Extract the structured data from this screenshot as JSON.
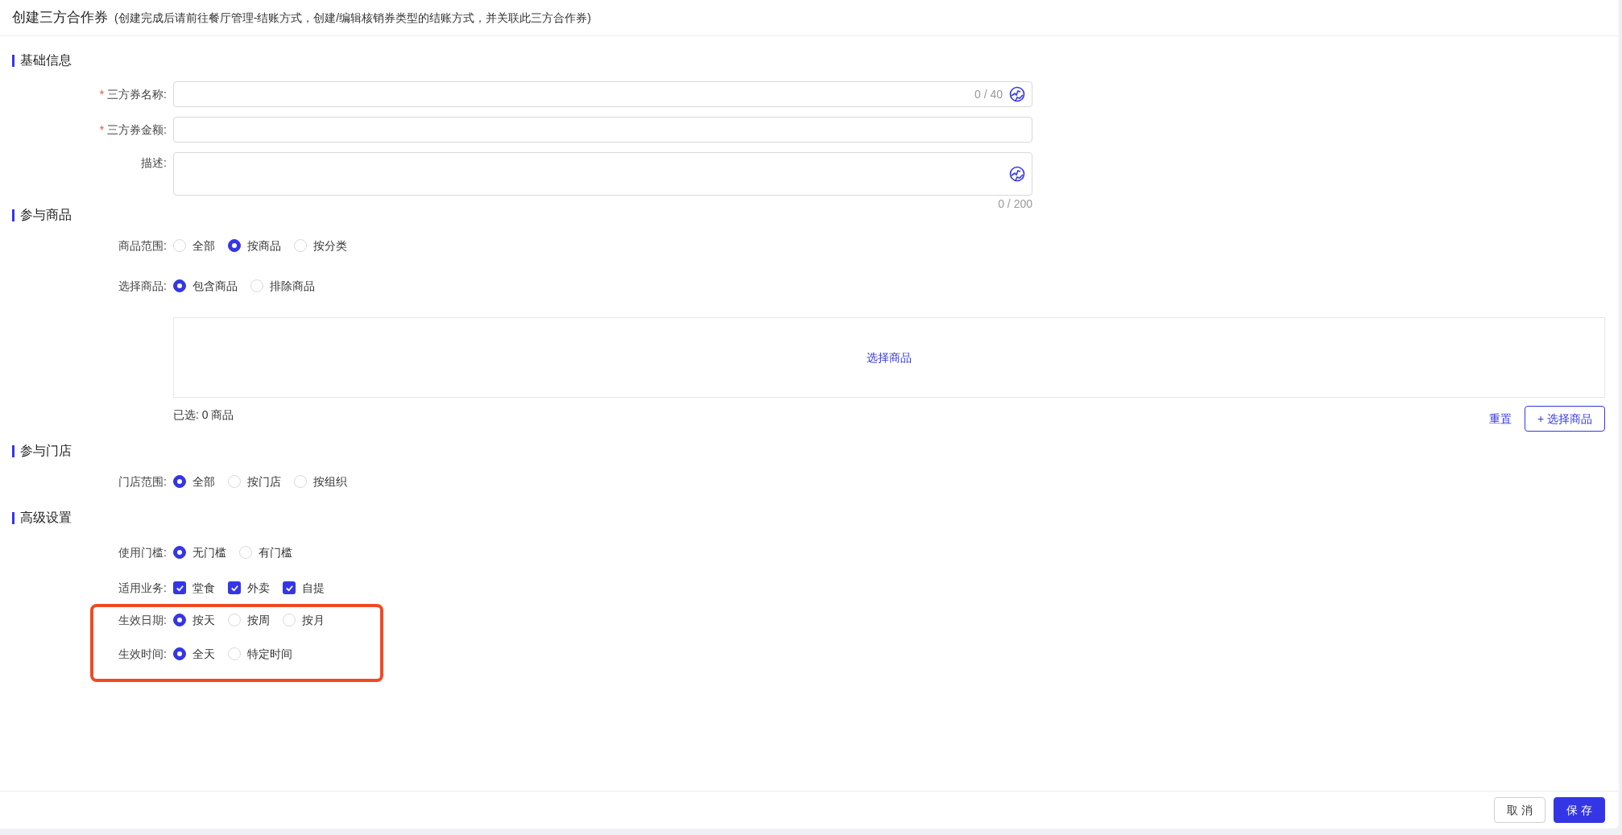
{
  "header": {
    "title": "创建三方合作券",
    "note": "(创建完成后请前往餐厅管理-结账方式，创建/编辑核销券类型的结账方式，并关联此三方合作券)"
  },
  "sections": [
    {
      "title": "基础信息",
      "fields": [
        {
          "kind": "input",
          "label": "三方券名称:",
          "required_mark": "*",
          "counter": "0 / 40",
          "icon_button": true
        },
        {
          "kind": "input",
          "label": "三方券金额:",
          "required_mark": "*",
          "icon_button": false
        },
        {
          "kind": "textarea",
          "label": "描述:",
          "counter": "0 / 200",
          "icon_button": true
        }
      ]
    },
    {
      "title": "参与商品",
      "fields": [
        {
          "kind": "radio",
          "label": "商品范围:",
          "highlighted": false,
          "options": [
            {
              "label": "全部",
              "selected": false
            },
            {
              "label": "按商品",
              "selected": true
            },
            {
              "label": "按分类",
              "selected": false
            }
          ]
        },
        {
          "kind": "radio",
          "label": "选择商品:",
          "highlighted": false,
          "options": [
            {
              "label": "包含商品",
              "selected": true
            },
            {
              "label": "排除商品",
              "selected": false
            }
          ]
        },
        {
          "kind": "picker",
          "link": "选择商品",
          "summary": "已选: 0 商品",
          "reset": "重置",
          "add": "+ 选择商品"
        }
      ]
    },
    {
      "title": "参与门店",
      "fields": [
        {
          "kind": "radio",
          "label": "门店范围:",
          "highlighted": false,
          "options": [
            {
              "label": "全部",
              "selected": true
            },
            {
              "label": "按门店",
              "selected": false
            },
            {
              "label": "按组织",
              "selected": false
            }
          ]
        }
      ]
    },
    {
      "title": "高级设置",
      "fields": [
        {
          "kind": "radio",
          "label": "使用门槛:",
          "highlighted": false,
          "options": [
            {
              "label": "无门槛",
              "selected": true
            },
            {
              "label": "有门槛",
              "selected": false
            }
          ]
        },
        {
          "kind": "checkbox",
          "label": "适用业务:",
          "highlighted": false,
          "options": [
            {
              "label": "堂食",
              "checked": true
            },
            {
              "label": "外卖",
              "checked": true
            },
            {
              "label": "自提",
              "checked": true
            }
          ]
        },
        {
          "kind": "radio",
          "label": "生效日期:",
          "highlighted": true,
          "options": [
            {
              "label": "按天",
              "selected": true
            },
            {
              "label": "按周",
              "selected": false
            },
            {
              "label": "按月",
              "selected": false
            }
          ]
        },
        {
          "kind": "radio",
          "label": "生效时间:",
          "highlighted": true,
          "options": [
            {
              "label": "全天",
              "selected": true
            },
            {
              "label": "特定时间",
              "selected": false
            }
          ]
        }
      ]
    }
  ],
  "footer": {
    "buttons": [
      {
        "label": "取消",
        "kind": "secondary"
      },
      {
        "label": "保存",
        "kind": "primary"
      }
    ]
  }
}
